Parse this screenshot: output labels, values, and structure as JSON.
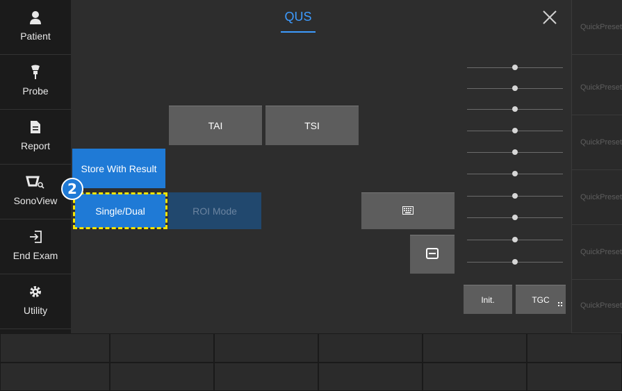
{
  "sidebar": {
    "items": [
      {
        "label": "Patient",
        "icon": "person-icon"
      },
      {
        "label": "Probe",
        "icon": "probe-icon"
      },
      {
        "label": "Report",
        "icon": "report-icon"
      },
      {
        "label": "SonoView",
        "icon": "sonoview-icon"
      },
      {
        "label": "End Exam",
        "icon": "end-exam-icon"
      },
      {
        "label": "Utility",
        "icon": "gear-icon"
      }
    ]
  },
  "header": {
    "title": "QUS"
  },
  "buttons": {
    "tai": "TAI",
    "tsi": "TSI",
    "store_with_result": "Store With Result",
    "single_dual": "Single/Dual",
    "roi_mode": "ROI Mode",
    "init": "Init.",
    "tgc": "TGC"
  },
  "presets": [
    "QuickPreset",
    "QuickPreset",
    "QuickPreset",
    "QuickPreset",
    "QuickPreset",
    "QuickPreset"
  ],
  "badge": {
    "number": "2"
  },
  "colors": {
    "accent": "#1f7ad6",
    "title": "#3d9bff",
    "highlight": "#f5e400"
  }
}
